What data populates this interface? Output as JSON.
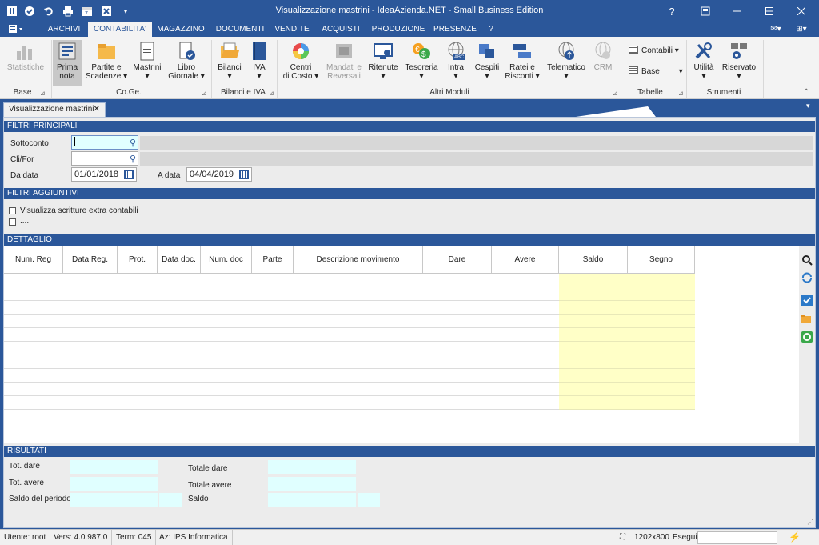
{
  "window": {
    "title": "Visualizzazione mastrini - IdeaAzienda.NET - Small Business Edition",
    "controls": [
      "?",
      "minimize",
      "maximize",
      "close"
    ]
  },
  "menu": {
    "tabs": [
      "ARCHIVI",
      "CONTABILITA'",
      "MAGAZZINO",
      "DOCUMENTI",
      "VENDITE",
      "ACQUISTI",
      "PRODUZIONE",
      "PRESENZE",
      "?"
    ],
    "active": "CONTABILITA'"
  },
  "ribbon": {
    "buttons": {
      "statistiche": "Statistiche",
      "prima_nota_1": "Prima",
      "prima_nota_2": "nota",
      "partite_1": "Partite e",
      "partite_2": "Scadenze ▾",
      "mastrini_1": "Mastrini",
      "mastrini_2": "▾",
      "libro_1": "Libro",
      "libro_2": "Giornale ▾",
      "bilanci_1": "Bilanci",
      "bilanci_2": "▾",
      "iva_1": "IVA",
      "iva_2": "▾",
      "centri_1": "Centri",
      "centri_2": "di Costo ▾",
      "mandati_1": "Mandati e",
      "mandati_2": "Reversali",
      "ritenute_1": "Ritenute",
      "ritenute_2": "▾",
      "tesoreria_1": "Tesoreria",
      "tesoreria_2": "▾",
      "intra_1": "Intra",
      "intra_2": "▾",
      "cespiti_1": "Cespiti",
      "cespiti_2": "▾",
      "ratei_1": "Ratei e",
      "ratei_2": "Risconti ▾",
      "telematico_1": "Telematico",
      "telematico_2": "▾",
      "crm": "CRM",
      "contabili": "Contabili ▾",
      "base": "Base",
      "utilita_1": "Utilità",
      "utilita_2": "▾",
      "riservato_1": "Riservato",
      "riservato_2": "▾"
    },
    "groups": {
      "base": "Base",
      "coge": "Co.Ge.",
      "bilanci_iva": "Bilanci e IVA",
      "altri": "Altri Moduli",
      "tabelle": "Tabelle",
      "strumenti": "Strumenti"
    }
  },
  "doc_tab": {
    "label": "Visualizzazione mastrini",
    "close": "✕"
  },
  "filtri_principali": {
    "header": "FILTRI PRINCIPALI",
    "sottoconto_label": "Sottoconto",
    "sottoconto_value": "",
    "clifor_label": "Cli/For",
    "clifor_value": "",
    "da_data_label": "Da data",
    "da_data_value": "01/01/2018",
    "a_data_label": "A data",
    "a_data_value": "04/04/2019"
  },
  "filtri_aggiuntivi": {
    "header": "FILTRI AGGIUNTIVI",
    "extra_label": "Visualizza scritture extra contabili",
    "extra_checked": false,
    "other_label": "....",
    "other_checked": false
  },
  "dettaglio": {
    "header": "DETTAGLIO",
    "columns": [
      "Num. Reg",
      "Data Reg.",
      "Prot.",
      "Data doc.",
      "Num. doc",
      "Parte",
      "Descrizione movimento",
      "Dare",
      "Avere",
      "Saldo",
      "Segno"
    ],
    "rows": []
  },
  "risultati": {
    "header": "RISULTATI",
    "tot_dare": "Tot. dare",
    "tot_avere": "Tot. avere",
    "saldo_periodo": "Saldo del periodo",
    "totale_dare": "Totale dare",
    "totale_avere": "Totale avere",
    "saldo": "Saldo"
  },
  "status": {
    "utente": "Utente: root",
    "versione": "Vers: 4.0.987.0",
    "terminale": "Term: 045",
    "azienda": "Az: IPS Informatica",
    "risoluzione": "1202x800",
    "esegui": "Esegui",
    "esegui_value": ""
  },
  "colors": {
    "accent": "#2b579a",
    "saldo_column": "#ffffc7",
    "result_field": "#e0ffff"
  }
}
